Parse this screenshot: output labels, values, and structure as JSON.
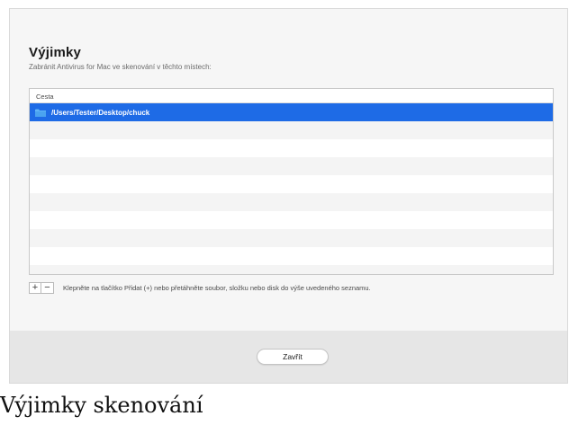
{
  "dialog": {
    "title": "Výjimky",
    "subtitle": "Zabránit Antivirus for Mac ve skenování v těchto místech:"
  },
  "table": {
    "column_header": "Cesta",
    "rows": [
      {
        "path": "/Users/Tester/Desktop/chuck",
        "icon": "folder-icon",
        "selected": true
      }
    ],
    "empty_row_count": 9
  },
  "toolbar": {
    "add_label": "+",
    "remove_label": "−",
    "hint": "Klepněte na tlačítko Přidat (+) nebo přetáhněte soubor, složku nebo disk do výše uvedeného seznamu."
  },
  "footer": {
    "close_label": "Zavřít"
  },
  "caption": "Výjimky skenování",
  "colors": {
    "selection": "#1e6be6",
    "folder": "#4aa3f0"
  }
}
